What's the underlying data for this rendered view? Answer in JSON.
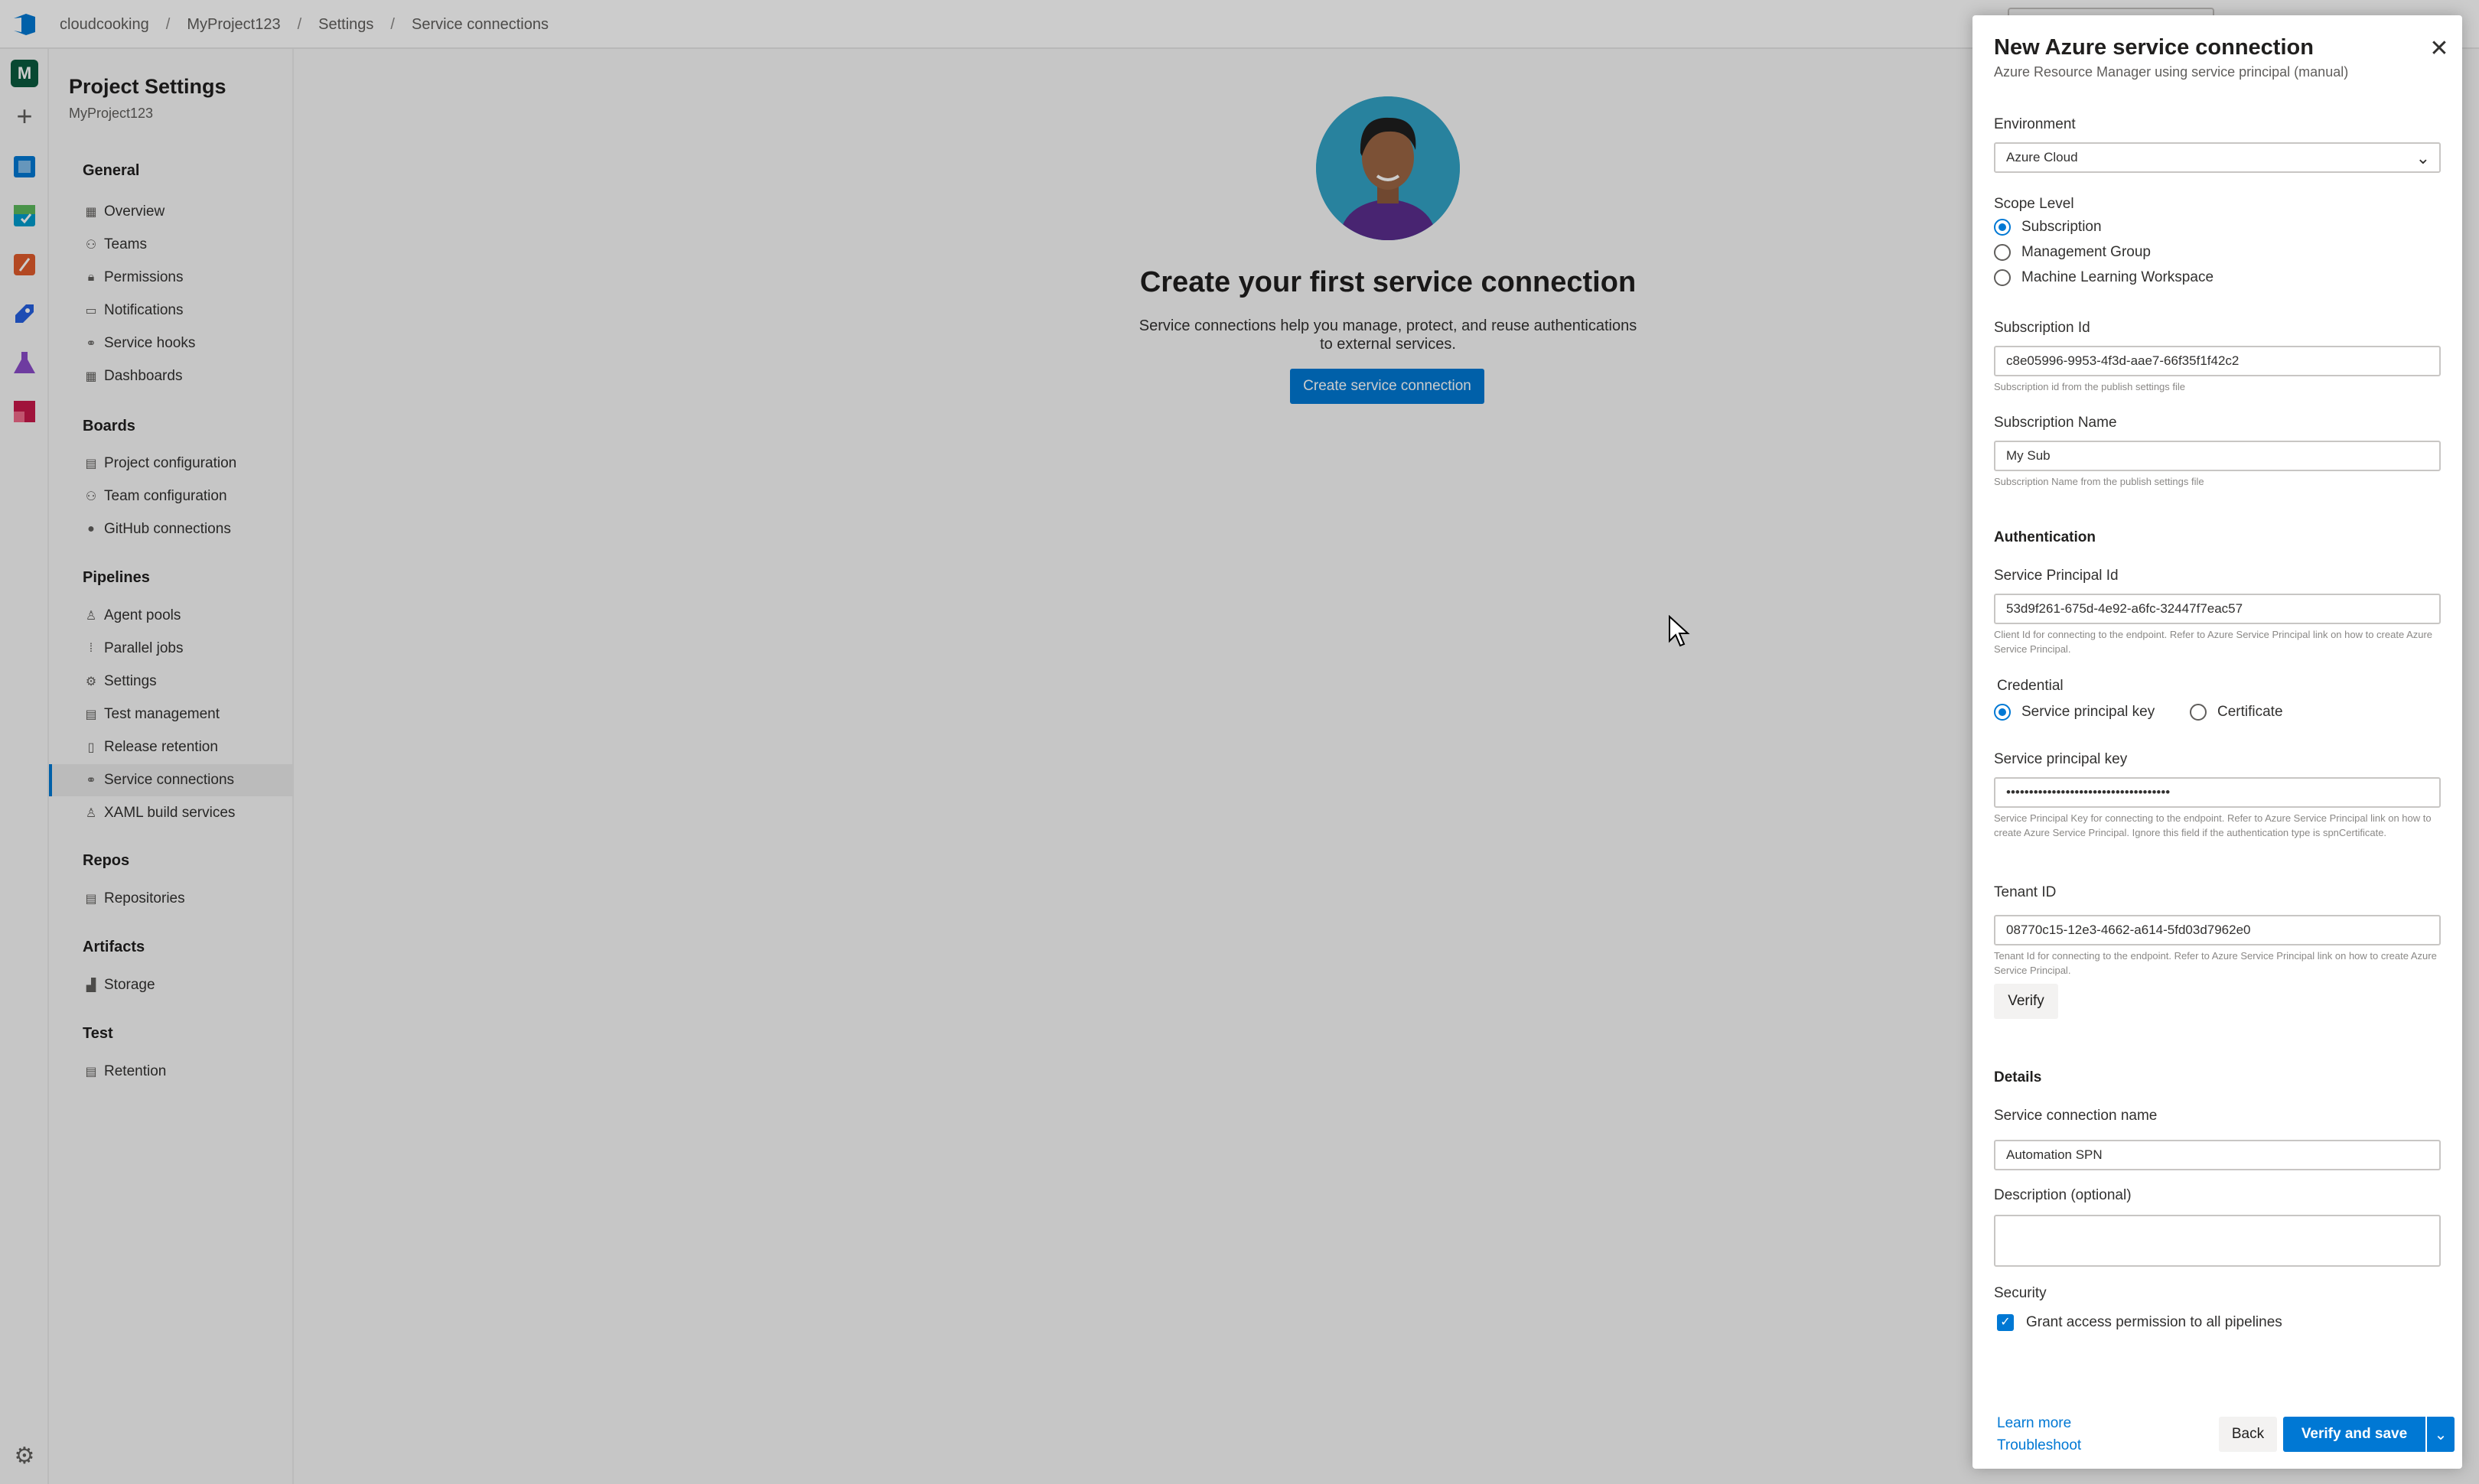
{
  "breadcrumb": {
    "items": [
      "cloudcooking",
      "MyProject123",
      "Settings",
      "Service connections"
    ],
    "separator": "/"
  },
  "rail": {
    "org_initial": "M",
    "plus_icon": "+",
    "gear_icon": "⚙",
    "expand_icon": "»"
  },
  "sidenav": {
    "title": "Project Settings",
    "subtitle": "MyProject123",
    "sections": {
      "general": "General",
      "boards": "Boards",
      "pipelines": "Pipelines",
      "repos": "Repos",
      "artifacts": "Artifacts",
      "test": "Test"
    },
    "items": {
      "overview": "Overview",
      "teams": "Teams",
      "permissions": "Permissions",
      "notifications": "Notifications",
      "service_hooks": "Service hooks",
      "dashboards": "Dashboards",
      "project_configuration": "Project configuration",
      "team_configuration": "Team configuration",
      "github_connections": "GitHub connections",
      "agent_pools": "Agent pools",
      "parallel_jobs": "Parallel jobs",
      "settings": "Settings",
      "test_management": "Test management",
      "release_retention": "Release retention",
      "service_connections": "Service connections",
      "xaml_build_services": "XAML build services",
      "repositories": "Repositories",
      "storage": "Storage",
      "retention": "Retention"
    },
    "selected": "Service connections"
  },
  "main": {
    "empty_title": "Create your first service connection",
    "empty_description": "Service connections help you manage, protect, and reuse authentications to external services.",
    "create_button": "Create service connection"
  },
  "panel": {
    "title": "New Azure service connection",
    "subtitle": "Azure Resource Manager using service principal (manual)",
    "close_icon": "✕",
    "environment": {
      "label": "Environment",
      "value": "Azure Cloud",
      "chevron": "⌄"
    },
    "scope_level": {
      "label": "Scope Level",
      "options": [
        "Subscription",
        "Management Group",
        "Machine Learning Workspace"
      ],
      "selected": "Subscription"
    },
    "subscription_id": {
      "label": "Subscription Id",
      "value": "c8e05996-9953-4f3d-aae7-66f35f1f42c2",
      "help": "Subscription id from the publish settings file"
    },
    "subscription_name": {
      "label": "Subscription Name",
      "value": "My Sub",
      "help": "Subscription Name from the publish settings file"
    },
    "authentication": {
      "heading": "Authentication",
      "sp_id_label": "Service Principal Id",
      "sp_id_value": "53d9f261-675d-4e92-a6fc-32447f7eac57",
      "sp_id_help": "Client Id for connecting to the endpoint. Refer to Azure Service Principal link on how to create Azure Service Principal.",
      "credential_label": "Credential",
      "credential_options": [
        "Service principal key",
        "Certificate"
      ],
      "credential_selected": "Service principal key",
      "key_label": "Service principal key",
      "key_value": "••••••••••••••••••••••••••••••••••••",
      "key_help": "Service Principal Key for connecting to the endpoint. Refer to Azure Service Principal link on how to create Azure Service Principal. Ignore this field if the authentication type is spnCertificate.",
      "tenant_label": "Tenant ID",
      "tenant_value": "08770c15-12e3-4662-a614-5fd03d7962e0",
      "tenant_help": "Tenant Id for connecting to the endpoint. Refer to Azure Service Principal link on how to create Azure Service Principal.",
      "verify_button": "Verify"
    },
    "details": {
      "heading": "Details",
      "name_label": "Service connection name",
      "name_value": "Automation SPN",
      "description_label": "Description (optional)",
      "description_value": ""
    },
    "security": {
      "label": "Security",
      "grant_label": "Grant access permission to all pipelines",
      "grant_checked": true,
      "check_icon": "✓"
    },
    "footer": {
      "learn_more": "Learn more",
      "troubleshoot": "Troubleshoot",
      "back_button": "Back",
      "save_button": "Verify and save",
      "save_dropdown_icon": "⌄"
    }
  },
  "colors": {
    "accent": "#0078d4",
    "org_badge": "#0b5a3f",
    "avatar_bg": "#33a3c6",
    "overlay": "rgba(0,0,0,0.2)"
  }
}
